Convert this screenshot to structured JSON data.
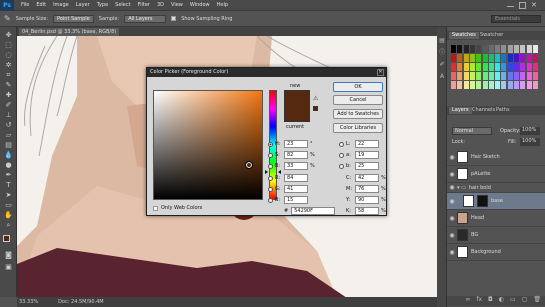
{
  "menubar": {
    "logo": "Ps",
    "items": [
      "File",
      "Edit",
      "Image",
      "Layer",
      "Type",
      "Select",
      "Filter",
      "3D",
      "View",
      "Window",
      "Help"
    ]
  },
  "options": {
    "sample_size_label": "Sample Size:",
    "sample_size_value": "Point Sample",
    "sample_label": "Sample:",
    "sample_value": "All Layers",
    "show_ring_label": "Show Sampling Ring",
    "workspace_value": "Essentials"
  },
  "document": {
    "tab_label": "04_Berlin.psd @ 33.3% (base, RGB/8)",
    "zoom": "33.33%",
    "doc_info": "Doc: 24.5M/90.4M"
  },
  "panels": {
    "swatches_tab": "Swatches",
    "second_tab": "Swatcher",
    "layers_tab": "Layers",
    "channels_tab": "Channels",
    "paths_tab": "Paths",
    "kind_label": "Normal",
    "opacity_label": "Opacity:",
    "opacity_value": "100%",
    "fill_label": "Fill:",
    "fill_value": "100%",
    "lock_label": "Lock:",
    "layers": [
      {
        "name": "Hair Sketch"
      },
      {
        "name": "pALette"
      },
      {
        "name": "hair bold"
      },
      {
        "name": "base"
      },
      {
        "name": "Head"
      },
      {
        "name": "BG"
      },
      {
        "name": "Background"
      }
    ]
  },
  "dialog": {
    "title": "Color Picker (Foreground Color)",
    "new_label": "new",
    "current_label": "current",
    "ok": "OK",
    "cancel": "Cancel",
    "add_swatches": "Add to Swatches",
    "libraries": "Color Libraries",
    "only_web": "Only Web Colors",
    "hash": "#",
    "hex": "54290F",
    "hsb": [
      {
        "label": "H:",
        "value": "23",
        "unit": "°"
      },
      {
        "label": "S:",
        "value": "82",
        "unit": "%"
      },
      {
        "label": "B:",
        "value": "33",
        "unit": "%"
      }
    ],
    "rgb": [
      {
        "label": "R:",
        "value": "84"
      },
      {
        "label": "G:",
        "value": "41"
      },
      {
        "label": "B:",
        "value": "15"
      }
    ],
    "lab": [
      {
        "label": "L:",
        "value": "22"
      },
      {
        "label": "a:",
        "value": "19"
      },
      {
        "label": "b:",
        "value": "25"
      }
    ],
    "cmyk": [
      {
        "label": "C:",
        "value": "42",
        "unit": "%"
      },
      {
        "label": "M:",
        "value": "76",
        "unit": "%"
      },
      {
        "label": "Y:",
        "value": "90",
        "unit": "%"
      },
      {
        "label": "K:",
        "value": "58",
        "unit": "%"
      }
    ]
  },
  "colors": {
    "foreground": "#54290f",
    "background": "#ffffff"
  }
}
